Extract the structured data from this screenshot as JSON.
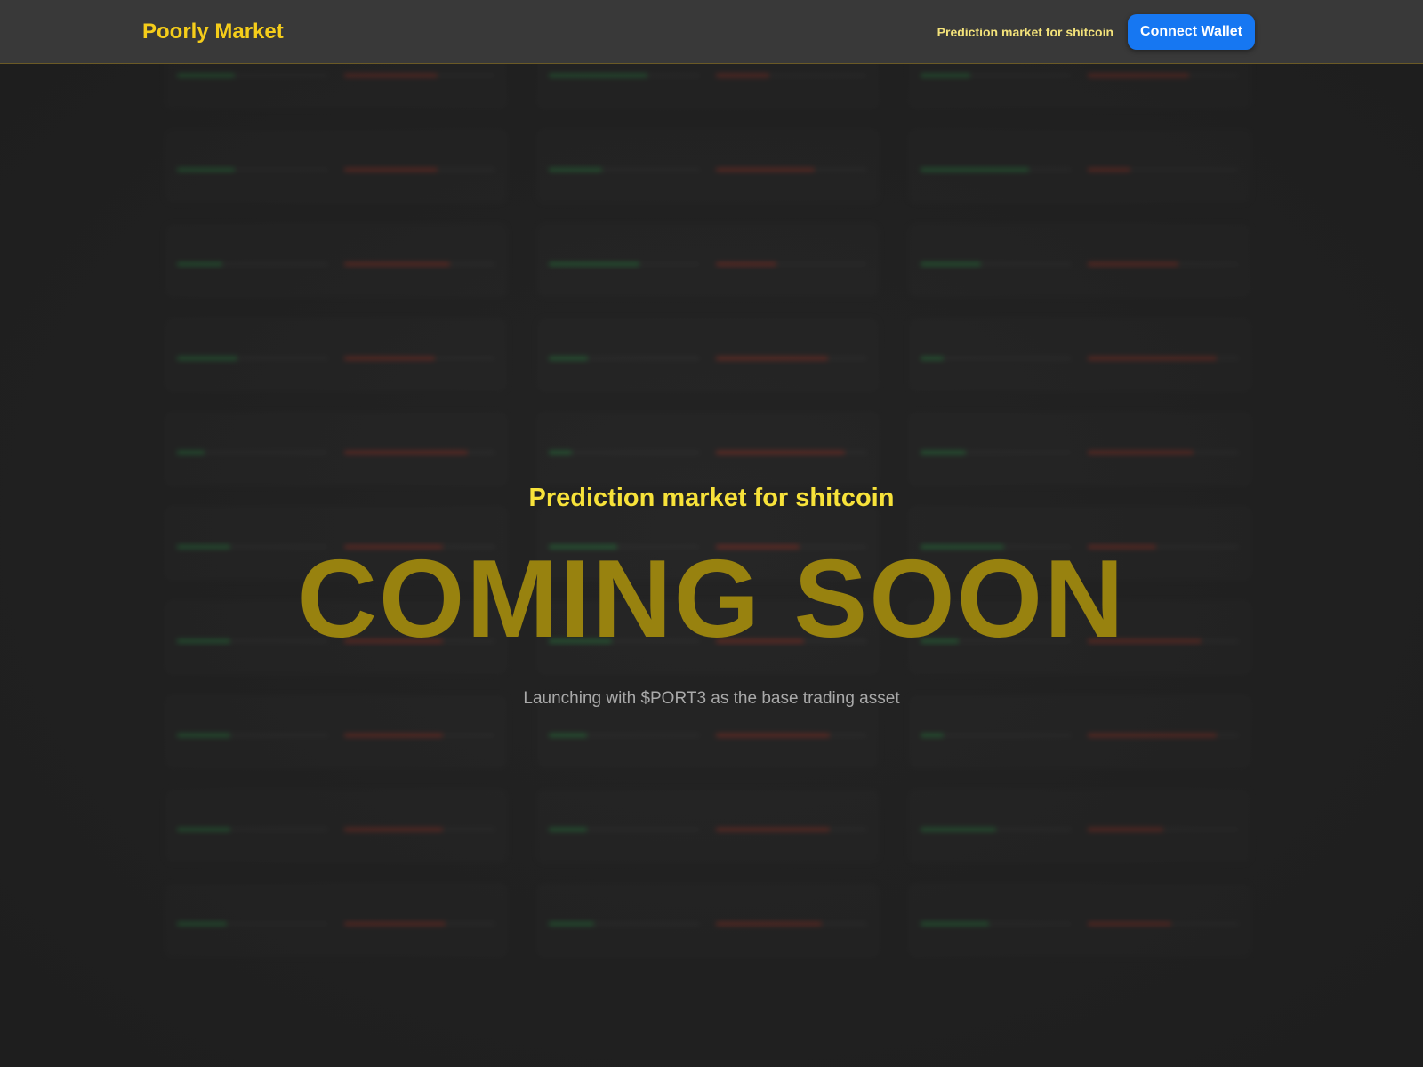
{
  "header": {
    "logo": "Poorly Market",
    "tagline": "Prediction market for shitcoin",
    "connect_label": "Connect Wallet"
  },
  "hero": {
    "tagline": "Prediction market for shitcoin",
    "title": "COMING SOON",
    "subtitle": "Launching with $PORT3 as the base trading asset"
  },
  "colors": {
    "accent": "#f5cd1a",
    "button": "#1677f2",
    "yes": "#2fa84f",
    "no": "#c0392b"
  },
  "background_markets": [
    {
      "yes": 0.38,
      "no": 0.62
    },
    {
      "yes": 0.65,
      "no": 0.35
    },
    {
      "yes": 0.33,
      "no": 0.67
    },
    {
      "yes": 0.38,
      "no": 0.62
    },
    {
      "yes": 0.35,
      "no": 0.65
    },
    {
      "yes": 0.72,
      "no": 0.28
    },
    {
      "yes": 0.3,
      "no": 0.7
    },
    {
      "yes": 0.6,
      "no": 0.4
    },
    {
      "yes": 0.4,
      "no": 0.6
    },
    {
      "yes": 0.4,
      "no": 0.6
    },
    {
      "yes": 0.26,
      "no": 0.74
    },
    {
      "yes": 0.15,
      "no": 0.85
    },
    {
      "yes": 0.18,
      "no": 0.82
    },
    {
      "yes": 0.15,
      "no": 0.85
    },
    {
      "yes": 0.3,
      "no": 0.7
    },
    {
      "yes": 0.35,
      "no": 0.65
    },
    {
      "yes": 0.45,
      "no": 0.55
    },
    {
      "yes": 0.55,
      "no": 0.45
    },
    {
      "yes": 0.35,
      "no": 0.65
    },
    {
      "yes": 0.42,
      "no": 0.58
    },
    {
      "yes": 0.25,
      "no": 0.75
    },
    {
      "yes": 0.35,
      "no": 0.65
    },
    {
      "yes": 0.25,
      "no": 0.75
    },
    {
      "yes": 0.15,
      "no": 0.85
    },
    {
      "yes": 0.35,
      "no": 0.65
    },
    {
      "yes": 0.25,
      "no": 0.75
    },
    {
      "yes": 0.5,
      "no": 0.5
    },
    {
      "yes": 0.33,
      "no": 0.67
    },
    {
      "yes": 0.3,
      "no": 0.7
    },
    {
      "yes": 0.45,
      "no": 0.55
    }
  ]
}
